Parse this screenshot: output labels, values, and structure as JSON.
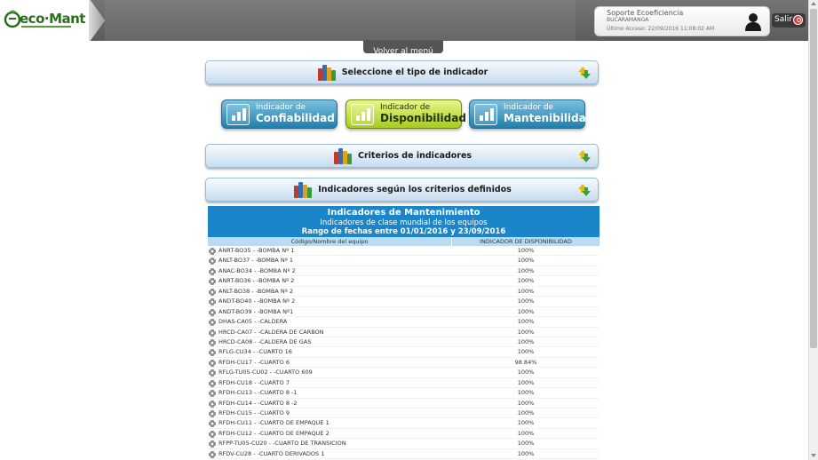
{
  "header": {
    "logo_text": "eco·Mant",
    "user": {
      "name": "Soporte Ecoeficiencia",
      "city": "BUCARAMANGA",
      "last_access": "Último Acceso: 22/09/2016 11:08:02 AM"
    },
    "logout_label": "Salir"
  },
  "nav": {
    "back_label": "Volver al menú"
  },
  "sections": {
    "tipo": "Seleccione el tipo de indicador",
    "criterios": "Criterios de indicadores",
    "resultados": "Indicadores según los criterios definidos"
  },
  "indicator_buttons": [
    {
      "small": "Indicador de",
      "big": "Confiabilidad",
      "active": false
    },
    {
      "small": "Indicador de",
      "big": "Disponibilidad",
      "active": true
    },
    {
      "small": "Indicador de",
      "big": "Mantenibilidad",
      "active": false
    }
  ],
  "report": {
    "title": "Indicadores de Mantenimiento",
    "subtitle": "Indicadores de clase mundial de los equipos",
    "range": "Rango de fechas entre 01/01/2016 y 23/09/2016",
    "columns": [
      "Código/Nombre del equipo",
      "INDICADOR DE DISPONIBILIDAD"
    ],
    "rows": [
      {
        "equipo": "ANRT-BO35 - -BOMBA Nº 1",
        "valor": "100%"
      },
      {
        "equipo": "ANLT-BO37 - -BOMBA Nº 1",
        "valor": "100%"
      },
      {
        "equipo": "ANAC-BO34 - -BOMBA Nº 2",
        "valor": "100%"
      },
      {
        "equipo": "ANRT-BO36 - -BOMBA Nº 2",
        "valor": "100%"
      },
      {
        "equipo": "ANLT-BO38 - -BOMBA Nº 2",
        "valor": "100%"
      },
      {
        "equipo": "ANDT-BO40 - -BOMBA Nº 2",
        "valor": "100%"
      },
      {
        "equipo": "ANDT-BO39 - -BOMBA Nº1",
        "valor": "100%"
      },
      {
        "equipo": "DHAS-CA05 - -CALDERA",
        "valor": "100%"
      },
      {
        "equipo": "HRCD-CA07 - -CALDERA DE CARBON",
        "valor": "100%"
      },
      {
        "equipo": "HRCD-CA08 - -CALDERA DE GAS",
        "valor": "100%"
      },
      {
        "equipo": "RFLG-CU34 - -CUARTO 16",
        "valor": "100%"
      },
      {
        "equipo": "RFDH-CU17 - -CUARTO 6",
        "valor": "98.84%"
      },
      {
        "equipo": "RFLG-TU05-CU02 - -CUARTO 609",
        "valor": "100%"
      },
      {
        "equipo": "RFDH-CU18 - -CUARTO 7",
        "valor": "100%"
      },
      {
        "equipo": "RFDH-CU13 - -CUARTO 8 -1",
        "valor": "100%"
      },
      {
        "equipo": "RFDH-CU14 - -CUARTO 8 -2",
        "valor": "100%"
      },
      {
        "equipo": "RFDH-CU15 - -CUARTO 9",
        "valor": "100%"
      },
      {
        "equipo": "RFDH-CU11 - -CUARTO DE EMPAQUE 1",
        "valor": "100%"
      },
      {
        "equipo": "RFDH-CU12 - -CUARTO DE EMPAQUE 2",
        "valor": "100%"
      },
      {
        "equipo": "RFPP-TU05-CU20 - -CUARTO DE TRANSICION",
        "valor": "100%"
      },
      {
        "equipo": "RFDV-CU28 - -CUARTO DERIVADOS 1",
        "valor": "100%"
      }
    ]
  },
  "colors": {
    "header_bg": "#666666",
    "section_bar": "#c6dcef",
    "button_blue": "#1f7fad",
    "button_green": "#a7cc1c",
    "report_header": "#1b85c9",
    "column_header": "#b9dcf3",
    "logout_icon": "#e03a3a"
  },
  "icons": [
    "logo-icon",
    "user-avatar-icon",
    "power-icon",
    "books-icon",
    "collapse-arrow-icon",
    "bar-chart-icon",
    "gear-icon"
  ]
}
